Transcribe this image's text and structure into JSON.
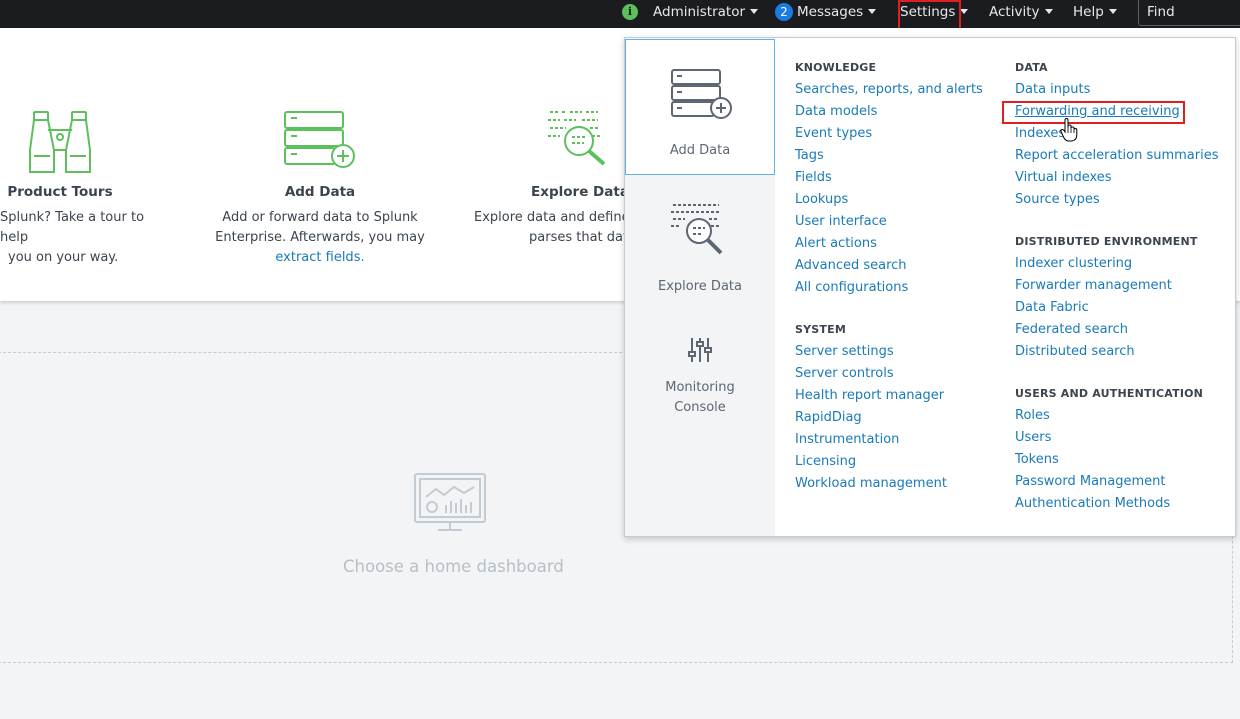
{
  "topbar": {
    "admin_label": "Administrator",
    "messages_count": "2",
    "messages_label": "Messages",
    "settings_label": "Settings",
    "activity_label": "Activity",
    "help_label": "Help",
    "find_placeholder": "Find"
  },
  "cards": {
    "product_tours": {
      "title": "Product Tours",
      "line1": "Splunk? Take a tour to help",
      "line2": "you on your way."
    },
    "add_data": {
      "title": "Add Data",
      "line1": "Add or forward data to Splunk",
      "line2": "Enterprise. Afterwards, you may",
      "link": "extract fields."
    },
    "explore_data": {
      "title": "Explore Data",
      "line1": "Explore data and define",
      "line2": "parses that data"
    }
  },
  "dashboard": {
    "label": "Choose a home dashboard"
  },
  "dropdown": {
    "tiles": {
      "add_data": "Add Data",
      "explore_data": "Explore Data",
      "monitoring_line1": "Monitoring",
      "monitoring_line2": "Console"
    },
    "knowledge": {
      "heading": "KNOWLEDGE",
      "items": [
        "Searches, reports, and alerts",
        "Data models",
        "Event types",
        "Tags",
        "Fields",
        "Lookups",
        "User interface",
        "Alert actions",
        "Advanced search",
        "All configurations"
      ]
    },
    "system": {
      "heading": "SYSTEM",
      "items": [
        "Server settings",
        "Server controls",
        "Health report manager",
        "RapidDiag",
        "Instrumentation",
        "Licensing",
        "Workload management"
      ]
    },
    "data": {
      "heading": "DATA",
      "items": [
        "Data inputs",
        "Forwarding and receiving",
        "Indexes",
        "Report acceleration summaries",
        "Virtual indexes",
        "Source types"
      ]
    },
    "distributed": {
      "heading": "DISTRIBUTED ENVIRONMENT",
      "items": [
        "Indexer clustering",
        "Forwarder management",
        "Data Fabric",
        "Federated search",
        "Distributed search"
      ]
    },
    "users": {
      "heading": "USERS AND AUTHENTICATION",
      "items": [
        "Roles",
        "Users",
        "Tokens",
        "Password Management",
        "Authentication Methods"
      ]
    }
  }
}
